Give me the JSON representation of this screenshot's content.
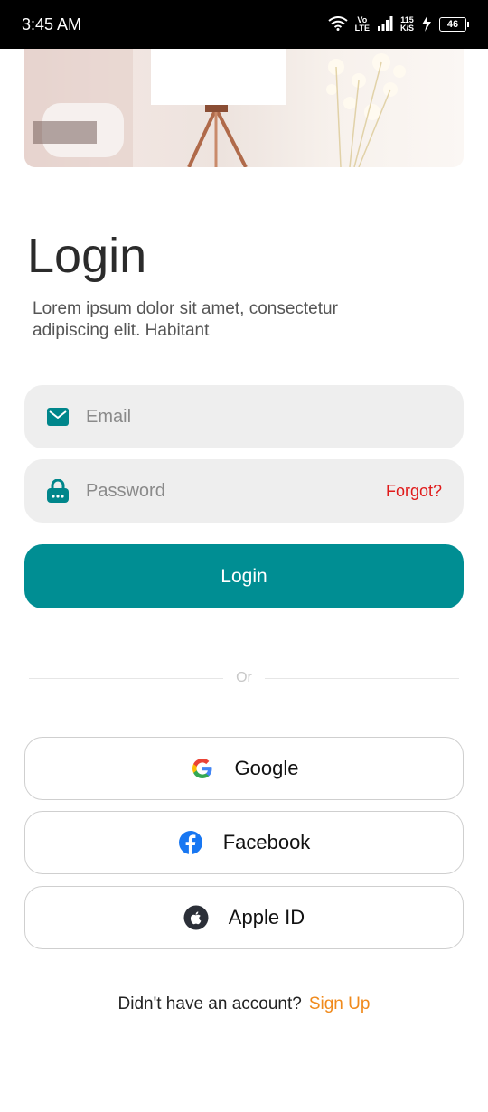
{
  "status_bar": {
    "time": "3:45 AM",
    "network_label_top": "Vo",
    "network_label_bottom": "LTE",
    "speed_top": "115",
    "speed_bottom": "K/S",
    "battery": "46"
  },
  "login": {
    "title": "Login",
    "subtitle": "Lorem ipsum dolor sit amet, consectetur adipiscing elit. Habitant",
    "email_placeholder": "Email",
    "password_placeholder": "Password",
    "forgot_label": "Forgot?",
    "login_button": "Login",
    "divider_text": "Or"
  },
  "social": [
    {
      "label": "Google",
      "icon": "google-icon"
    },
    {
      "label": "Facebook",
      "icon": "facebook-icon"
    },
    {
      "label": "Apple ID",
      "icon": "apple-icon"
    }
  ],
  "footer": {
    "prompt": "Didn't have an account?",
    "signup_label": "Sign Up"
  },
  "colors": {
    "accent": "#008e93",
    "forgot": "#e01a1a",
    "signup": "#f08a1c"
  }
}
